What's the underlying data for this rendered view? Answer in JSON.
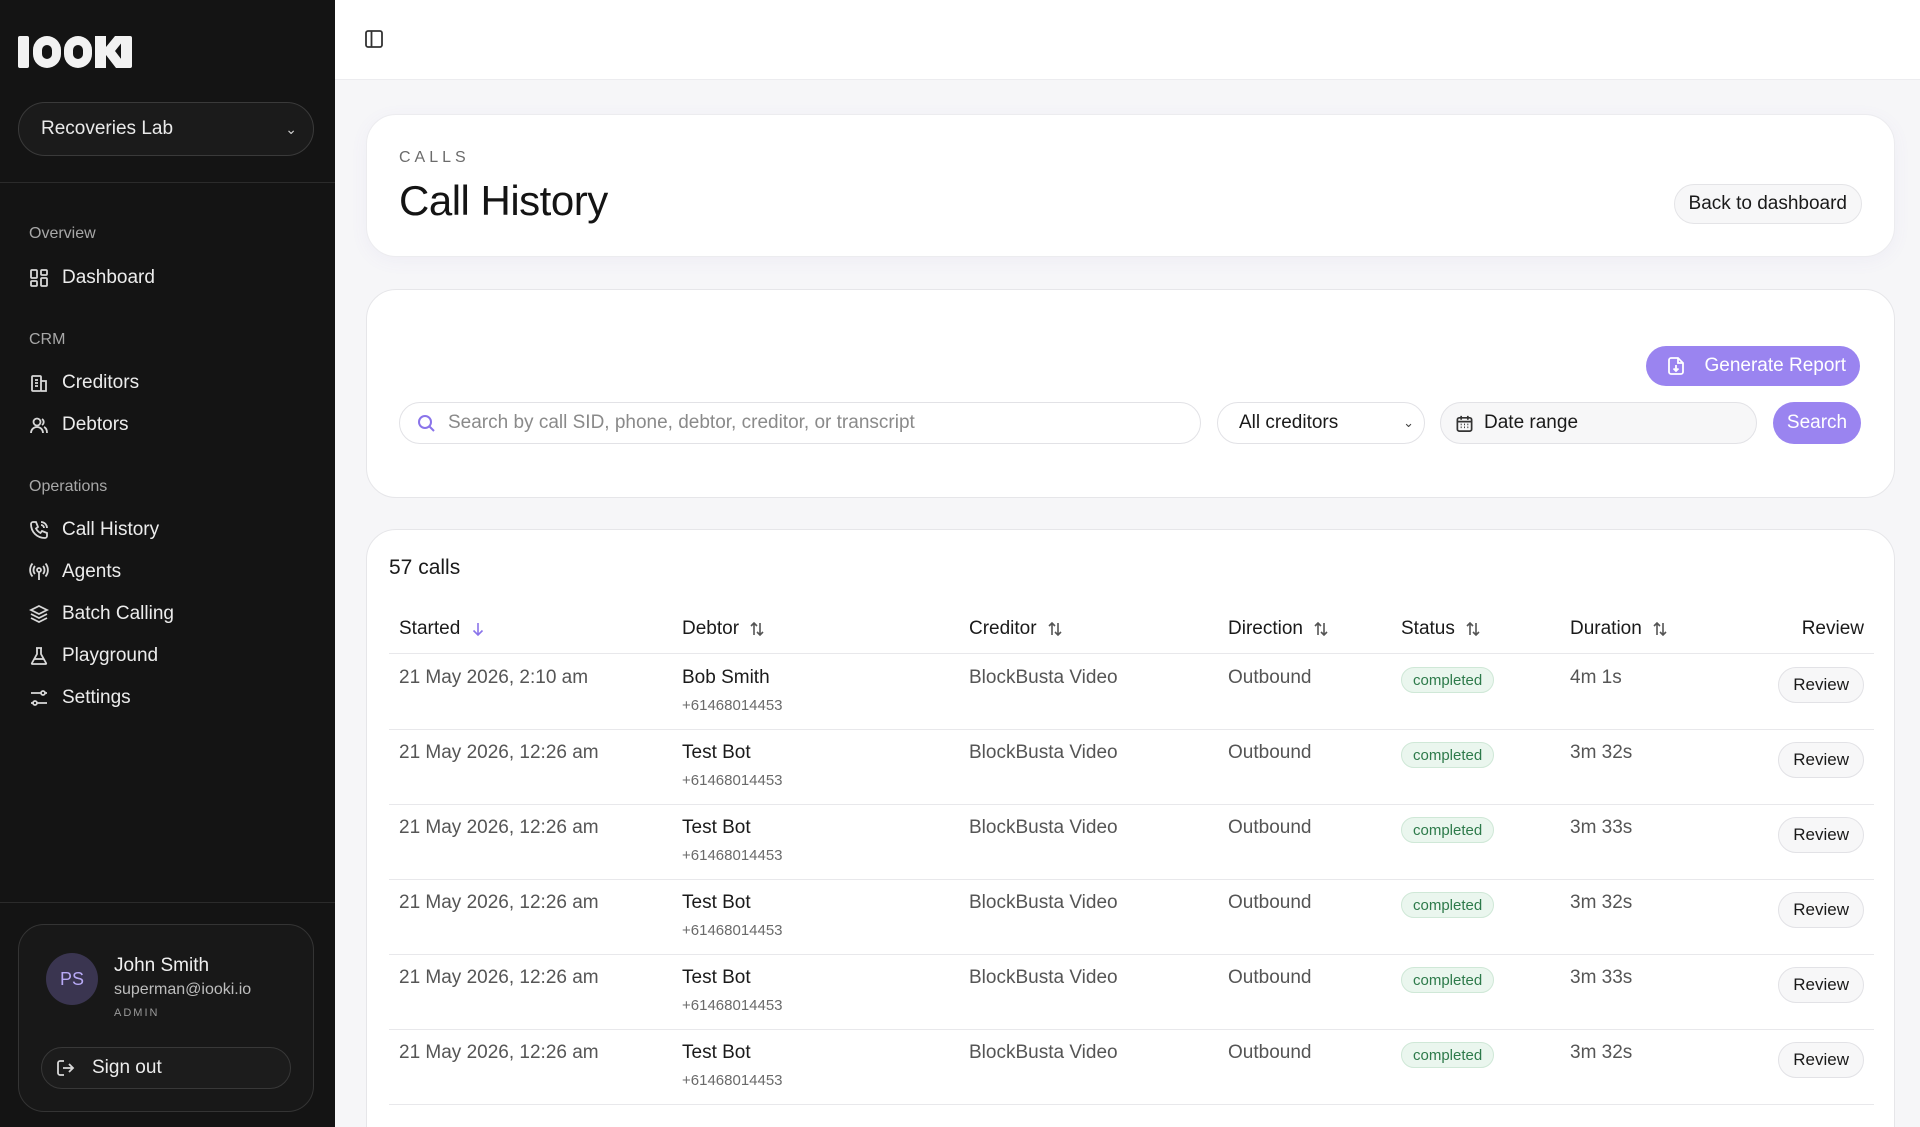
{
  "app": {
    "logo_text": "IOOKI",
    "org_name": "Recoveries Lab"
  },
  "sidebar": {
    "sections": [
      {
        "label": "Overview",
        "items": [
          {
            "label": "Dashboard",
            "icon": "dashboard-icon"
          }
        ]
      },
      {
        "label": "CRM",
        "items": [
          {
            "label": "Creditors",
            "icon": "building-icon"
          },
          {
            "label": "Debtors",
            "icon": "users-icon"
          }
        ]
      },
      {
        "label": "Operations",
        "items": [
          {
            "label": "Call History",
            "icon": "phone-icon"
          },
          {
            "label": "Agents",
            "icon": "radio-icon"
          },
          {
            "label": "Batch Calling",
            "icon": "layers-icon"
          },
          {
            "label": "Playground",
            "icon": "flask-icon"
          },
          {
            "label": "Settings",
            "icon": "sliders-icon"
          }
        ]
      }
    ],
    "user": {
      "initials": "PS",
      "name": "John Smith",
      "email": "superman@iooki.io",
      "role": "ADMIN",
      "signout_label": "Sign out"
    }
  },
  "header": {
    "eyebrow": "CALLS",
    "title": "Call History",
    "back_label": "Back to dashboard"
  },
  "filters": {
    "generate_report_label": "Generate Report",
    "search_placeholder": "Search by call SID, phone, debtor, creditor, or transcript",
    "creditor_selected": "All creditors",
    "date_range_label": "Date range",
    "search_button_label": "Search"
  },
  "table": {
    "count_label": "57 calls",
    "columns": [
      "Started",
      "Debtor",
      "Creditor",
      "Direction",
      "Status",
      "Duration",
      "Review"
    ],
    "rows": [
      {
        "started": "21 May 2026, 2:10 am",
        "debtor": "Bob Smith",
        "phone": "+61468014453",
        "creditor": "BlockBusta Video",
        "direction": "Outbound",
        "status": "completed",
        "duration": "4m 1s",
        "review": "Review"
      },
      {
        "started": "21 May 2026, 12:26 am",
        "debtor": "Test Bot",
        "phone": "+61468014453",
        "creditor": "BlockBusta Video",
        "direction": "Outbound",
        "status": "completed",
        "duration": "3m 32s",
        "review": "Review"
      },
      {
        "started": "21 May 2026, 12:26 am",
        "debtor": "Test Bot",
        "phone": "+61468014453",
        "creditor": "BlockBusta Video",
        "direction": "Outbound",
        "status": "completed",
        "duration": "3m 33s",
        "review": "Review"
      },
      {
        "started": "21 May 2026, 12:26 am",
        "debtor": "Test Bot",
        "phone": "+61468014453",
        "creditor": "BlockBusta Video",
        "direction": "Outbound",
        "status": "completed",
        "duration": "3m 32s",
        "review": "Review"
      },
      {
        "started": "21 May 2026, 12:26 am",
        "debtor": "Test Bot",
        "phone": "+61468014453",
        "creditor": "BlockBusta Video",
        "direction": "Outbound",
        "status": "completed",
        "duration": "3m 33s",
        "review": "Review"
      },
      {
        "started": "21 May 2026, 12:26 am",
        "debtor": "Test Bot",
        "phone": "+61468014453",
        "creditor": "BlockBusta Video",
        "direction": "Outbound",
        "status": "completed",
        "duration": "3m 32s",
        "review": "Review"
      }
    ]
  },
  "colors": {
    "sidebar_bg": "#141414",
    "accent": "#9a84f0",
    "status_completed": "#2d7a4a"
  }
}
